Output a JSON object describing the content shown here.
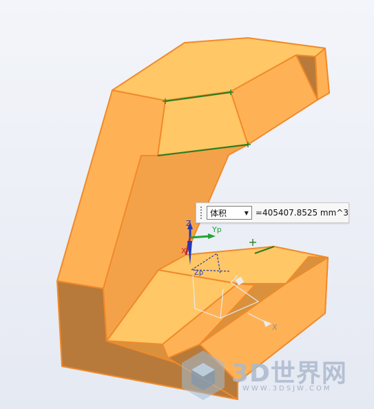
{
  "measure": {
    "type_label": "体积",
    "value_text": "=405407.8525 mm^3"
  },
  "axes": {
    "z": "Z",
    "x": "X",
    "yp": "Yp",
    "zp": "Zp",
    "x_screen": "X"
  },
  "watermark": {
    "brand": "3D世界网",
    "url": "WWW.3DSJW.COM"
  },
  "colors": {
    "face_light": "#ffc766",
    "face_mid": "#ffb255",
    "face_dark": "#b87a3a",
    "edge": "#f08a2a",
    "edge_green": "#2e7d1f"
  }
}
